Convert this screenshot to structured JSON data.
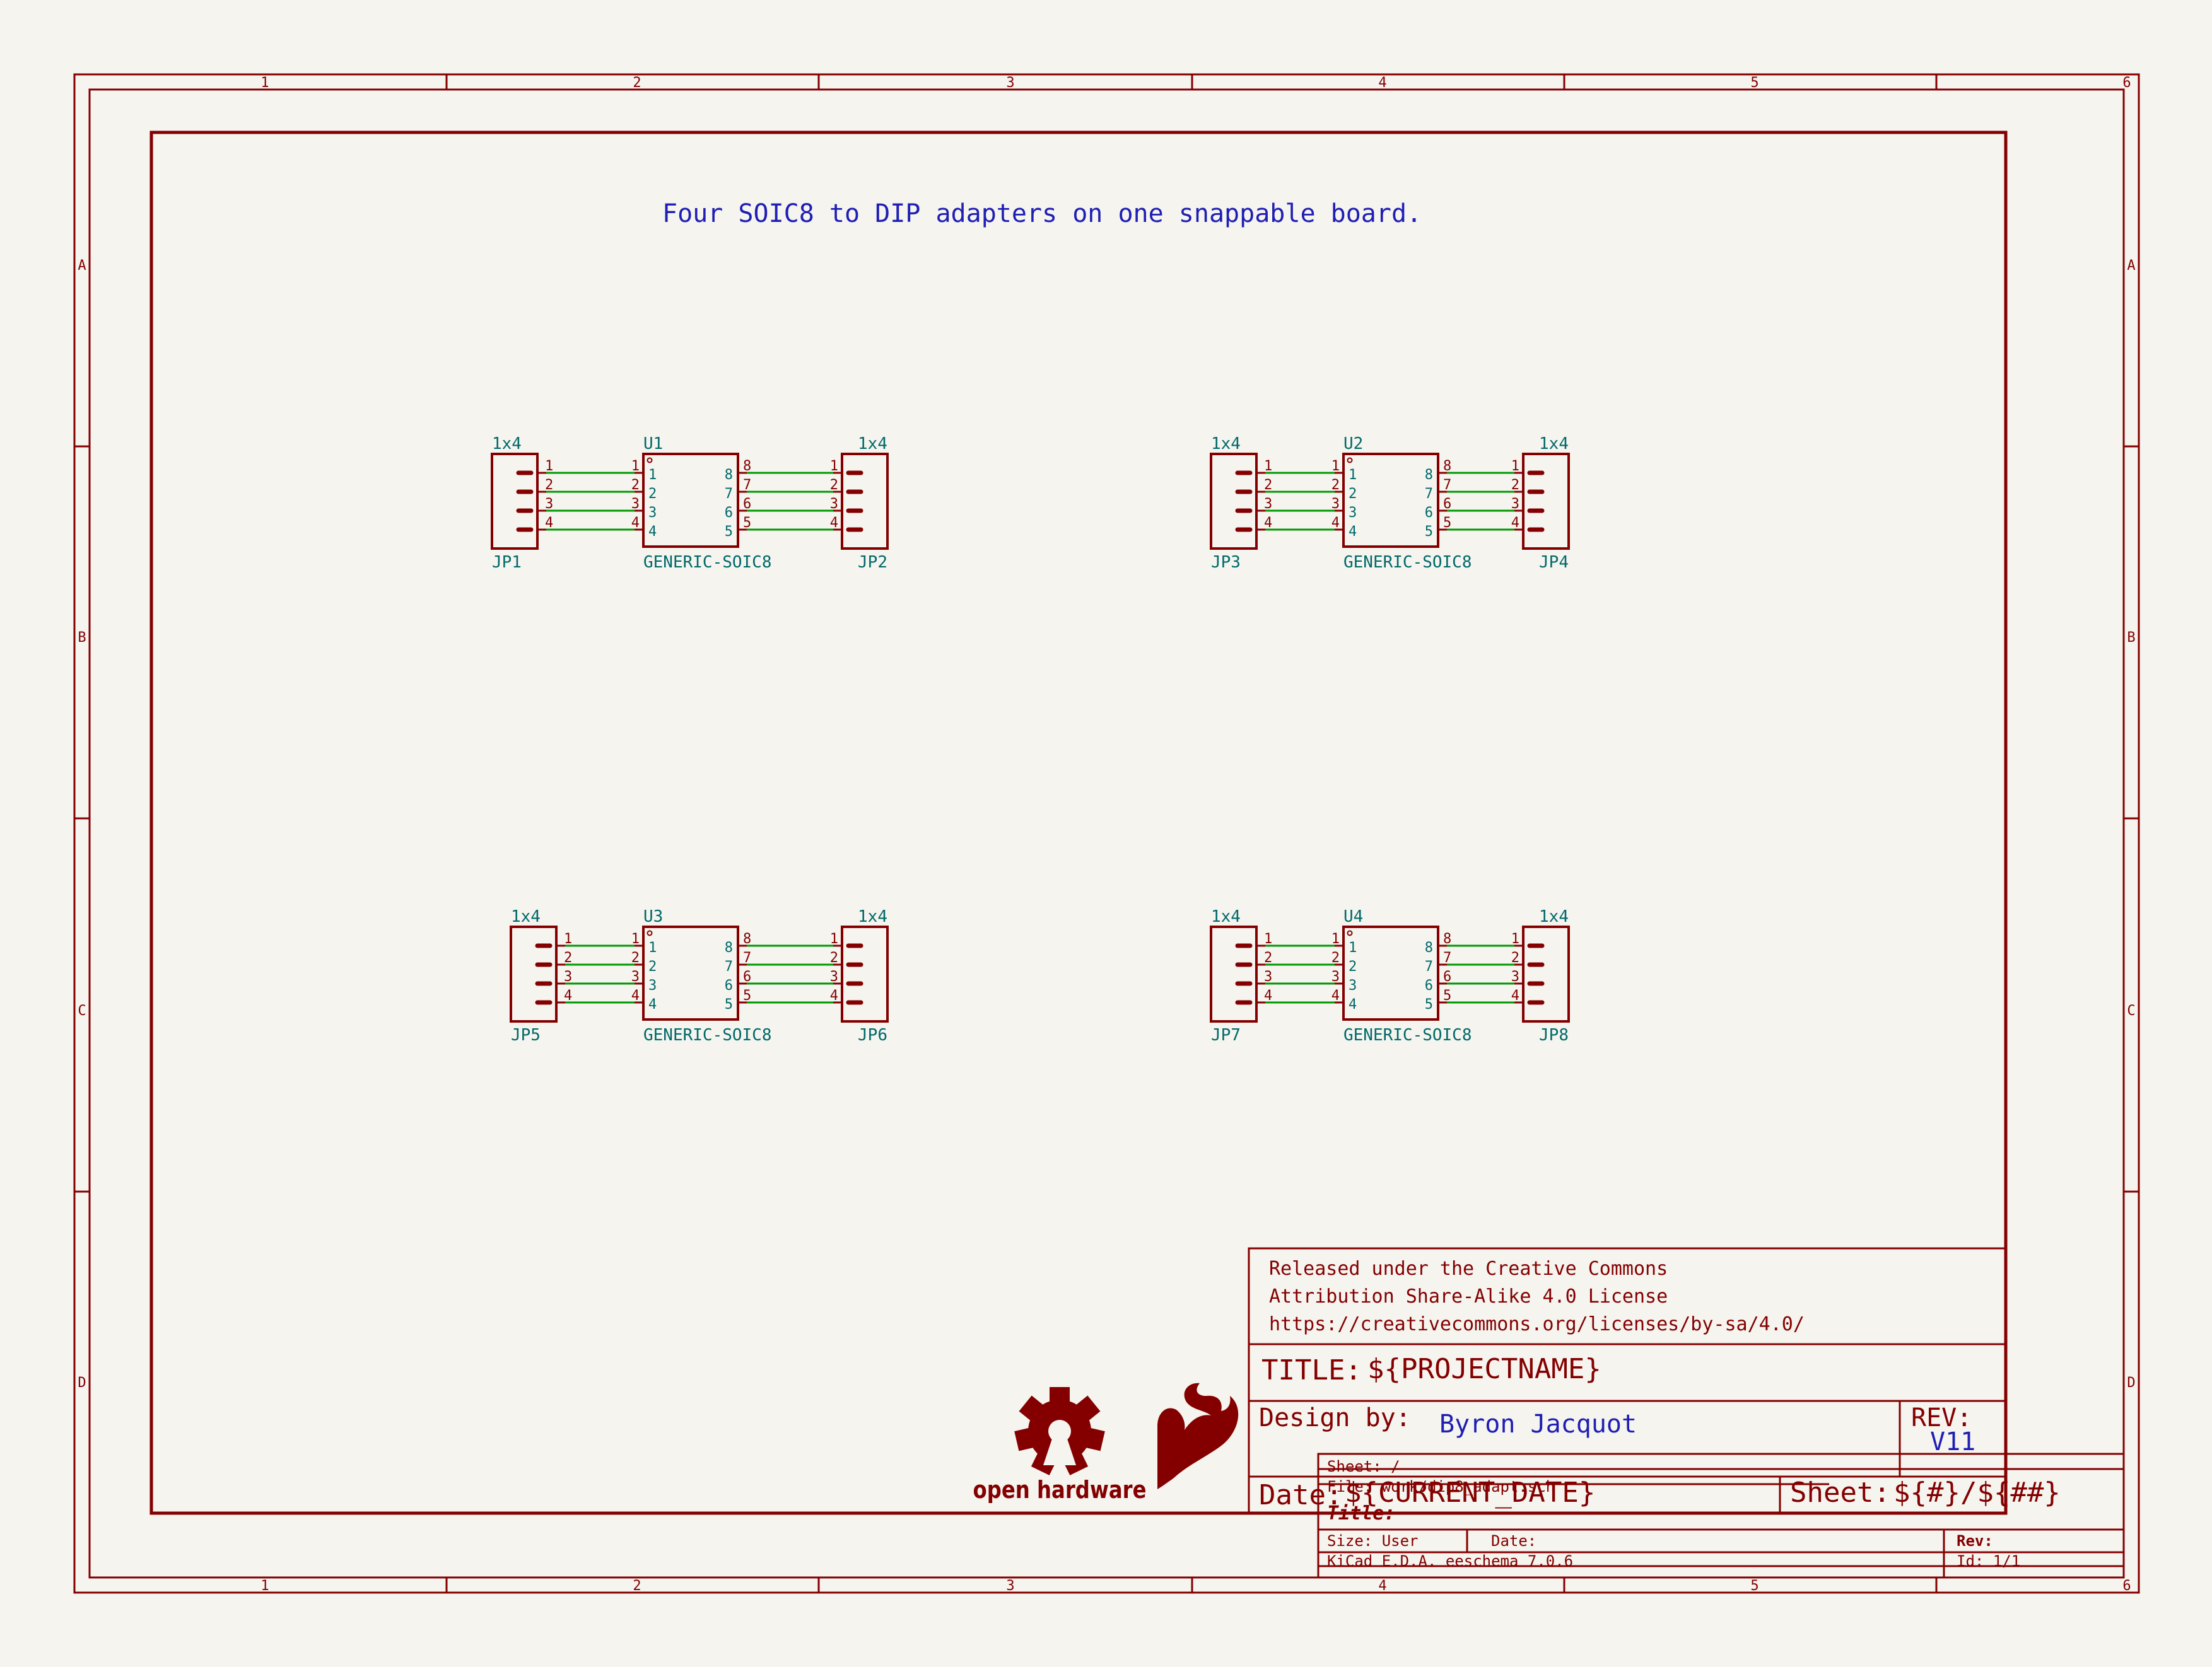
{
  "colors": {
    "background": "#f5f4ef",
    "frame": "#840000",
    "component": "#840000",
    "wire": "#009900",
    "label": "#006969",
    "note": "#1e1eb4"
  },
  "frame": {
    "columns": [
      "1",
      "2",
      "3",
      "4",
      "5",
      "6"
    ],
    "rows": [
      "A",
      "B",
      "C",
      "D"
    ]
  },
  "note": "Four SOIC8 to DIP adapters on one snappable board.",
  "adapters": [
    {
      "left": {
        "value": "1x4",
        "ref": "JP1"
      },
      "chip": {
        "ref": "U1",
        "value": "GENERIC-SOIC8"
      },
      "right": {
        "value": "1x4",
        "ref": "JP2"
      },
      "header_pins": [
        "1",
        "2",
        "3",
        "4"
      ],
      "chip_left_pins": [
        "1",
        "2",
        "3",
        "4"
      ],
      "chip_right_pins": [
        "8",
        "7",
        "6",
        "5"
      ]
    },
    {
      "left": {
        "value": "1x4",
        "ref": "JP3"
      },
      "chip": {
        "ref": "U2",
        "value": "GENERIC-SOIC8"
      },
      "right": {
        "value": "1x4",
        "ref": "JP4"
      },
      "header_pins": [
        "1",
        "2",
        "3",
        "4"
      ],
      "chip_left_pins": [
        "1",
        "2",
        "3",
        "4"
      ],
      "chip_right_pins": [
        "8",
        "7",
        "6",
        "5"
      ]
    },
    {
      "left": {
        "value": "1x4",
        "ref": "JP5"
      },
      "chip": {
        "ref": "U3",
        "value": "GENERIC-SOIC8"
      },
      "right": {
        "value": "1x4",
        "ref": "JP6"
      },
      "header_pins": [
        "1",
        "2",
        "3",
        "4"
      ],
      "chip_left_pins": [
        "1",
        "2",
        "3",
        "4"
      ],
      "chip_right_pins": [
        "8",
        "7",
        "6",
        "5"
      ]
    },
    {
      "left": {
        "value": "1x4",
        "ref": "JP7"
      },
      "chip": {
        "ref": "U4",
        "value": "GENERIC-SOIC8"
      },
      "right": {
        "value": "1x4",
        "ref": "JP8"
      },
      "header_pins": [
        "1",
        "2",
        "3",
        "4"
      ],
      "chip_left_pins": [
        "1",
        "2",
        "3",
        "4"
      ],
      "chip_right_pins": [
        "8",
        "7",
        "6",
        "5"
      ]
    }
  ],
  "logo": {
    "text": "open hardware"
  },
  "custom_block": {
    "license_lines": [
      "Released under the Creative Commons",
      "Attribution Share-Alike 4.0 License",
      "https://creativecommons.org/licenses/by-sa/4.0/"
    ],
    "title_label": "TITLE:",
    "title_value": "${PROJECTNAME}",
    "design_label": "Design by:",
    "designer": "Byron Jacquot",
    "rev_label": "REV:",
    "rev_value": "V11",
    "date_label": "Date:",
    "date_value": "${CURRENT_DATE}",
    "sheet_label": "Sheet:",
    "sheet_value": "${#}/${##}"
  },
  "kicad_block": {
    "sheet": "Sheet: /",
    "file": "File: work/dip8_adapt.sch",
    "title": "Title:",
    "size": "Size: User",
    "date": "Date:",
    "rev": "Rev:",
    "tool": "KiCad E.D.A.  eeschema 7.0.6",
    "id": "Id: 1/1"
  }
}
